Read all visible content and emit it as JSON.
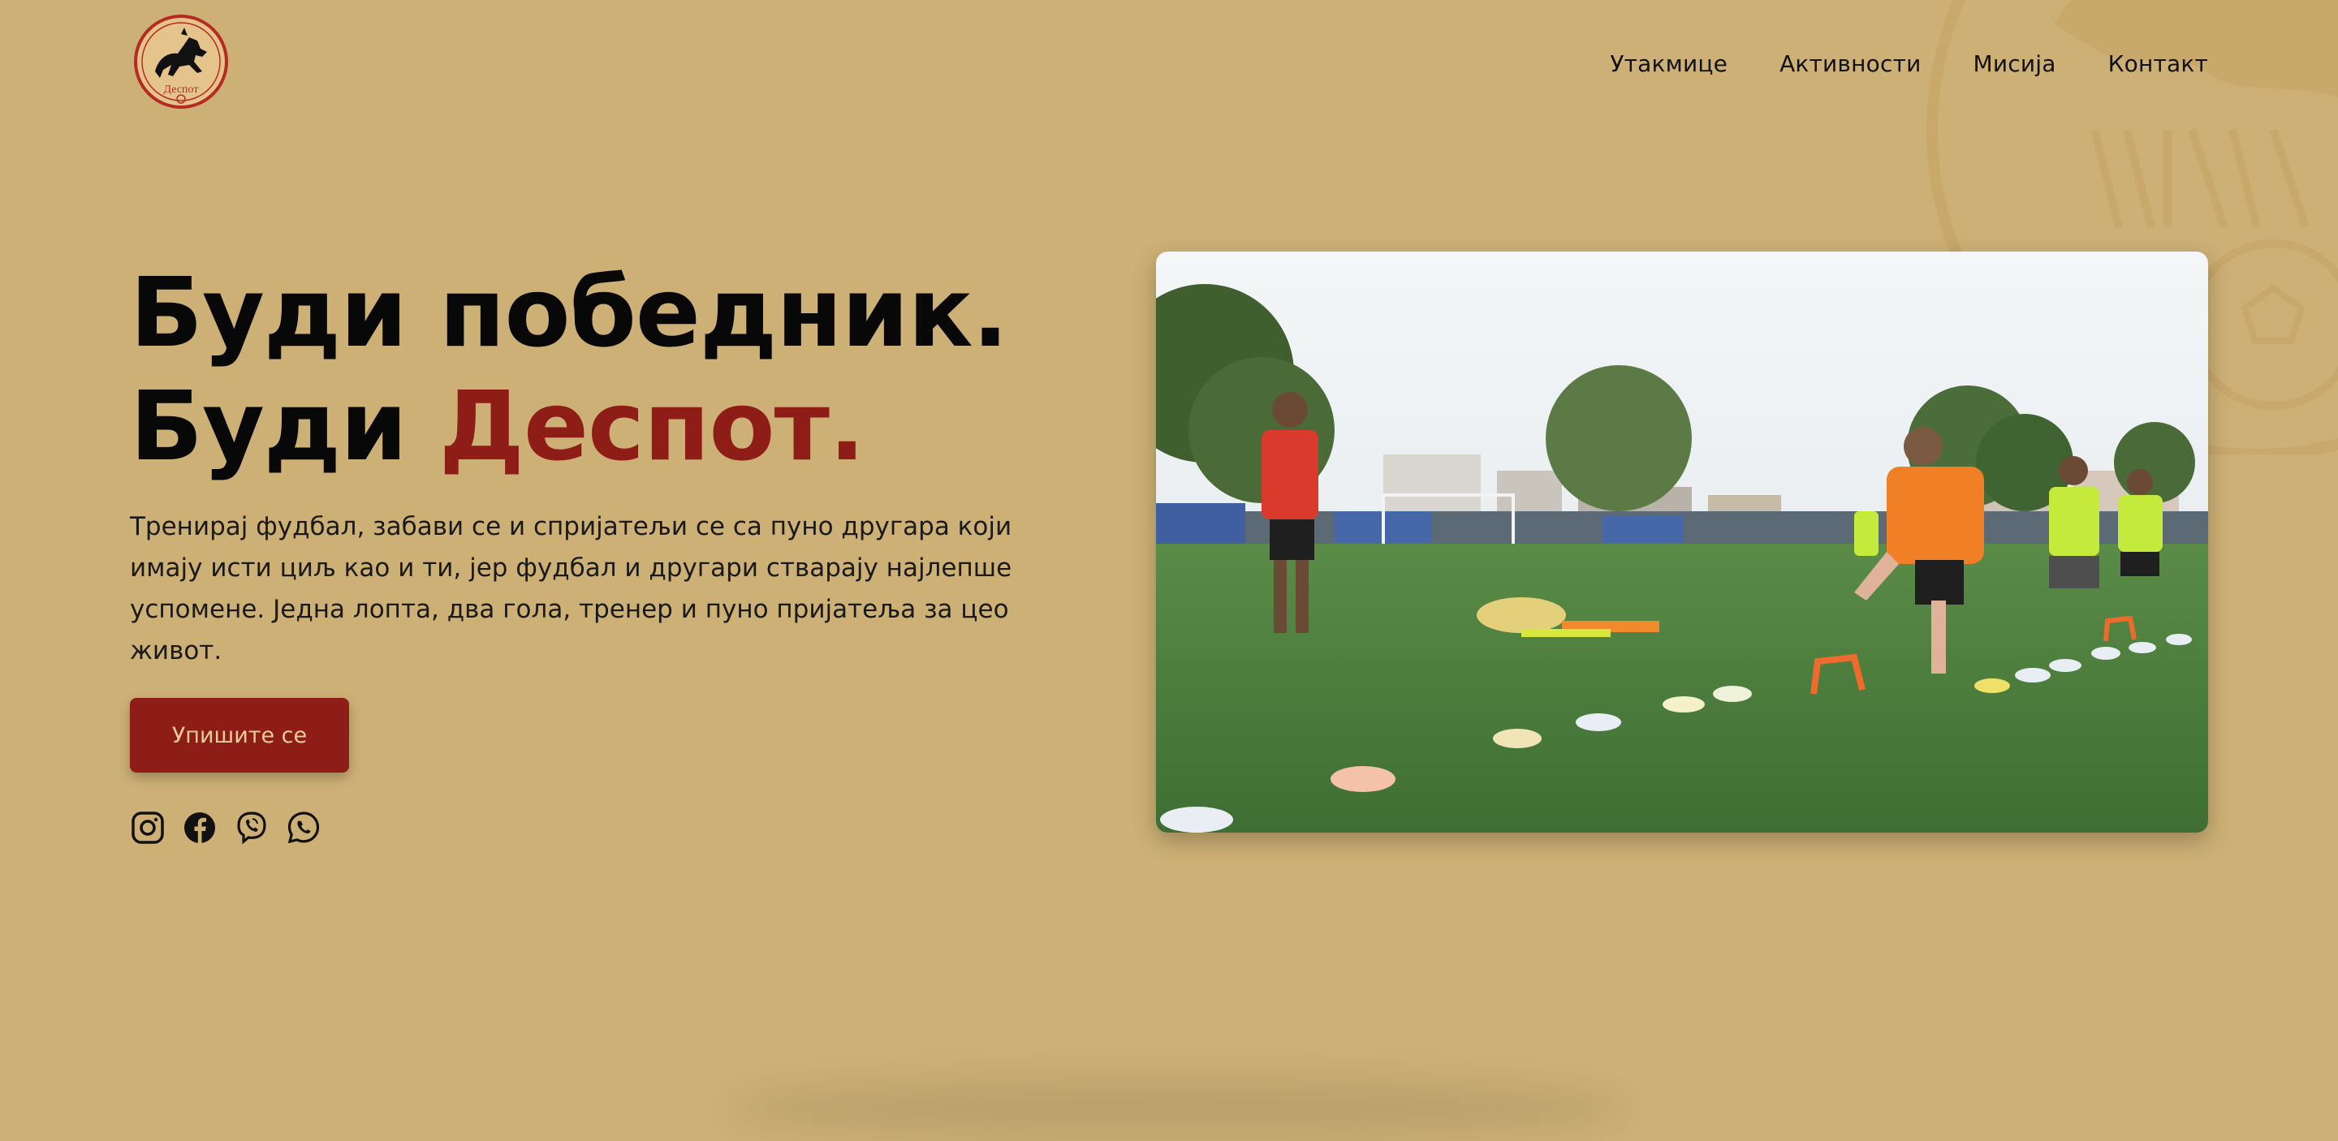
{
  "brand": {
    "logo_icon": "club-crest-logo",
    "logo_text": "Деспот",
    "accent_color": "#8e1d17",
    "background_color": "#cdb075"
  },
  "nav": {
    "items": [
      {
        "label": "Утакмице"
      },
      {
        "label": "Активности"
      },
      {
        "label": "Мисија"
      },
      {
        "label": "Контакт"
      }
    ]
  },
  "hero": {
    "headline_line1": "Буди победник.",
    "headline_line2_prefix": "Буди ",
    "headline_line2_accent": "Деспот.",
    "description": "Тренирај фудбал, забави се и спријатељи се са пуно другара који имају исти циљ као и ти, јер фудбал и другари стварају најлепше успомене. Једна лопта, два гола, тренер и пуно пријатеља за цео живот.",
    "cta_label": "Упишите се",
    "media_icon": "football-training-photo"
  },
  "socials": [
    {
      "icon": "instagram-icon"
    },
    {
      "icon": "facebook-icon"
    },
    {
      "icon": "viber-icon"
    },
    {
      "icon": "whatsapp-icon"
    }
  ]
}
